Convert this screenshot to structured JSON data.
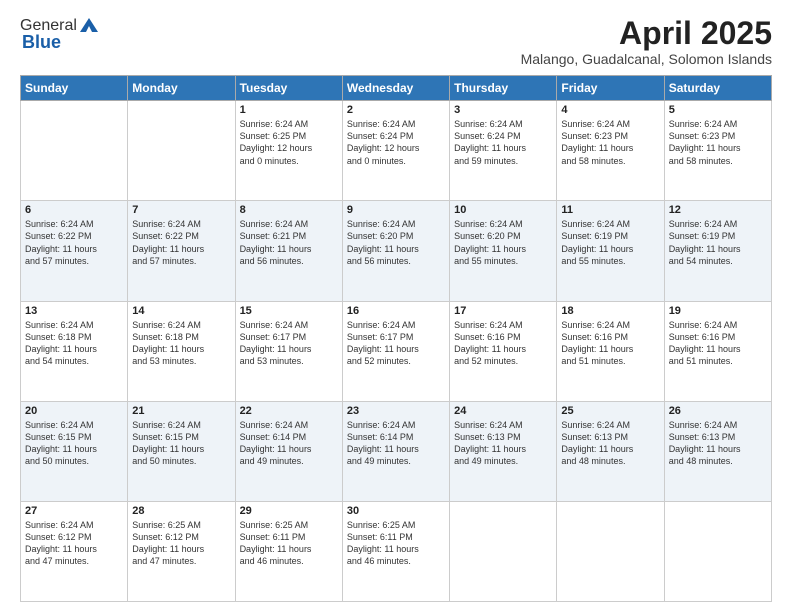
{
  "header": {
    "logo_general": "General",
    "logo_blue": "Blue",
    "month": "April 2025",
    "location": "Malango, Guadalcanal, Solomon Islands"
  },
  "weekdays": [
    "Sunday",
    "Monday",
    "Tuesday",
    "Wednesday",
    "Thursday",
    "Friday",
    "Saturday"
  ],
  "weeks": [
    [
      {
        "day": "",
        "info": ""
      },
      {
        "day": "",
        "info": ""
      },
      {
        "day": "1",
        "info": "Sunrise: 6:24 AM\nSunset: 6:25 PM\nDaylight: 12 hours\nand 0 minutes."
      },
      {
        "day": "2",
        "info": "Sunrise: 6:24 AM\nSunset: 6:24 PM\nDaylight: 12 hours\nand 0 minutes."
      },
      {
        "day": "3",
        "info": "Sunrise: 6:24 AM\nSunset: 6:24 PM\nDaylight: 11 hours\nand 59 minutes."
      },
      {
        "day": "4",
        "info": "Sunrise: 6:24 AM\nSunset: 6:23 PM\nDaylight: 11 hours\nand 58 minutes."
      },
      {
        "day": "5",
        "info": "Sunrise: 6:24 AM\nSunset: 6:23 PM\nDaylight: 11 hours\nand 58 minutes."
      }
    ],
    [
      {
        "day": "6",
        "info": "Sunrise: 6:24 AM\nSunset: 6:22 PM\nDaylight: 11 hours\nand 57 minutes."
      },
      {
        "day": "7",
        "info": "Sunrise: 6:24 AM\nSunset: 6:22 PM\nDaylight: 11 hours\nand 57 minutes."
      },
      {
        "day": "8",
        "info": "Sunrise: 6:24 AM\nSunset: 6:21 PM\nDaylight: 11 hours\nand 56 minutes."
      },
      {
        "day": "9",
        "info": "Sunrise: 6:24 AM\nSunset: 6:20 PM\nDaylight: 11 hours\nand 56 minutes."
      },
      {
        "day": "10",
        "info": "Sunrise: 6:24 AM\nSunset: 6:20 PM\nDaylight: 11 hours\nand 55 minutes."
      },
      {
        "day": "11",
        "info": "Sunrise: 6:24 AM\nSunset: 6:19 PM\nDaylight: 11 hours\nand 55 minutes."
      },
      {
        "day": "12",
        "info": "Sunrise: 6:24 AM\nSunset: 6:19 PM\nDaylight: 11 hours\nand 54 minutes."
      }
    ],
    [
      {
        "day": "13",
        "info": "Sunrise: 6:24 AM\nSunset: 6:18 PM\nDaylight: 11 hours\nand 54 minutes."
      },
      {
        "day": "14",
        "info": "Sunrise: 6:24 AM\nSunset: 6:18 PM\nDaylight: 11 hours\nand 53 minutes."
      },
      {
        "day": "15",
        "info": "Sunrise: 6:24 AM\nSunset: 6:17 PM\nDaylight: 11 hours\nand 53 minutes."
      },
      {
        "day": "16",
        "info": "Sunrise: 6:24 AM\nSunset: 6:17 PM\nDaylight: 11 hours\nand 52 minutes."
      },
      {
        "day": "17",
        "info": "Sunrise: 6:24 AM\nSunset: 6:16 PM\nDaylight: 11 hours\nand 52 minutes."
      },
      {
        "day": "18",
        "info": "Sunrise: 6:24 AM\nSunset: 6:16 PM\nDaylight: 11 hours\nand 51 minutes."
      },
      {
        "day": "19",
        "info": "Sunrise: 6:24 AM\nSunset: 6:16 PM\nDaylight: 11 hours\nand 51 minutes."
      }
    ],
    [
      {
        "day": "20",
        "info": "Sunrise: 6:24 AM\nSunset: 6:15 PM\nDaylight: 11 hours\nand 50 minutes."
      },
      {
        "day": "21",
        "info": "Sunrise: 6:24 AM\nSunset: 6:15 PM\nDaylight: 11 hours\nand 50 minutes."
      },
      {
        "day": "22",
        "info": "Sunrise: 6:24 AM\nSunset: 6:14 PM\nDaylight: 11 hours\nand 49 minutes."
      },
      {
        "day": "23",
        "info": "Sunrise: 6:24 AM\nSunset: 6:14 PM\nDaylight: 11 hours\nand 49 minutes."
      },
      {
        "day": "24",
        "info": "Sunrise: 6:24 AM\nSunset: 6:13 PM\nDaylight: 11 hours\nand 49 minutes."
      },
      {
        "day": "25",
        "info": "Sunrise: 6:24 AM\nSunset: 6:13 PM\nDaylight: 11 hours\nand 48 minutes."
      },
      {
        "day": "26",
        "info": "Sunrise: 6:24 AM\nSunset: 6:13 PM\nDaylight: 11 hours\nand 48 minutes."
      }
    ],
    [
      {
        "day": "27",
        "info": "Sunrise: 6:24 AM\nSunset: 6:12 PM\nDaylight: 11 hours\nand 47 minutes."
      },
      {
        "day": "28",
        "info": "Sunrise: 6:25 AM\nSunset: 6:12 PM\nDaylight: 11 hours\nand 47 minutes."
      },
      {
        "day": "29",
        "info": "Sunrise: 6:25 AM\nSunset: 6:11 PM\nDaylight: 11 hours\nand 46 minutes."
      },
      {
        "day": "30",
        "info": "Sunrise: 6:25 AM\nSunset: 6:11 PM\nDaylight: 11 hours\nand 46 minutes."
      },
      {
        "day": "",
        "info": ""
      },
      {
        "day": "",
        "info": ""
      },
      {
        "day": "",
        "info": ""
      }
    ]
  ]
}
